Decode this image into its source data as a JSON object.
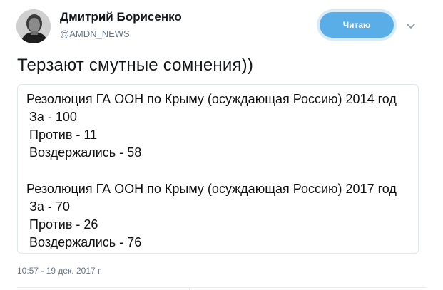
{
  "author": {
    "name": "Дмитрий Борисенко",
    "handle": "@AMDN_NEWS",
    "avatar_icon": "user-photo-avatar"
  },
  "follow_button": {
    "label": "Читаю",
    "color": "#5aaee8"
  },
  "menu_icon": "chevron-down-icon",
  "tweet": {
    "text": "Терзают смутные сомнения))",
    "timestamp": "10:57 - 19 дек. 2017 г."
  },
  "media": {
    "block_2014": {
      "title": "Резолюция ГА ООН по Крыму (осуждающая Россию) 2014 год",
      "for": "За - 100",
      "against": "Против - 11",
      "abstained": "Воздержались - 58"
    },
    "block_2017": {
      "title": "Резолюция ГА ООН по Крыму (осуждающая Россию) 2017 год",
      "for": "За - 70",
      "against": "Против - 26",
      "abstained": "Воздержались - 76"
    }
  }
}
